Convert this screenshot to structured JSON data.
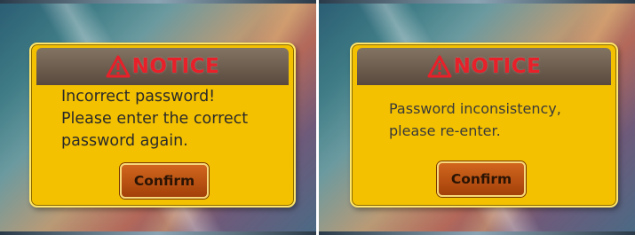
{
  "panels": [
    {
      "notice_title": "NOTICE",
      "message_lines": [
        "Incorrect password!",
        "Please enter the correct",
        "password again."
      ],
      "confirm_label": "Confirm"
    },
    {
      "notice_title": "NOTICE",
      "message_lines": [
        "Password inconsistency,",
        "please re-enter."
      ],
      "confirm_label": "Confirm"
    }
  ],
  "icons": {
    "warning": "warning-triangle-icon"
  },
  "colors": {
    "dialog_background": "#f4c100",
    "header_background": "#6b5c4d",
    "notice_text": "#e8202a",
    "button_background": "#b8500f"
  }
}
